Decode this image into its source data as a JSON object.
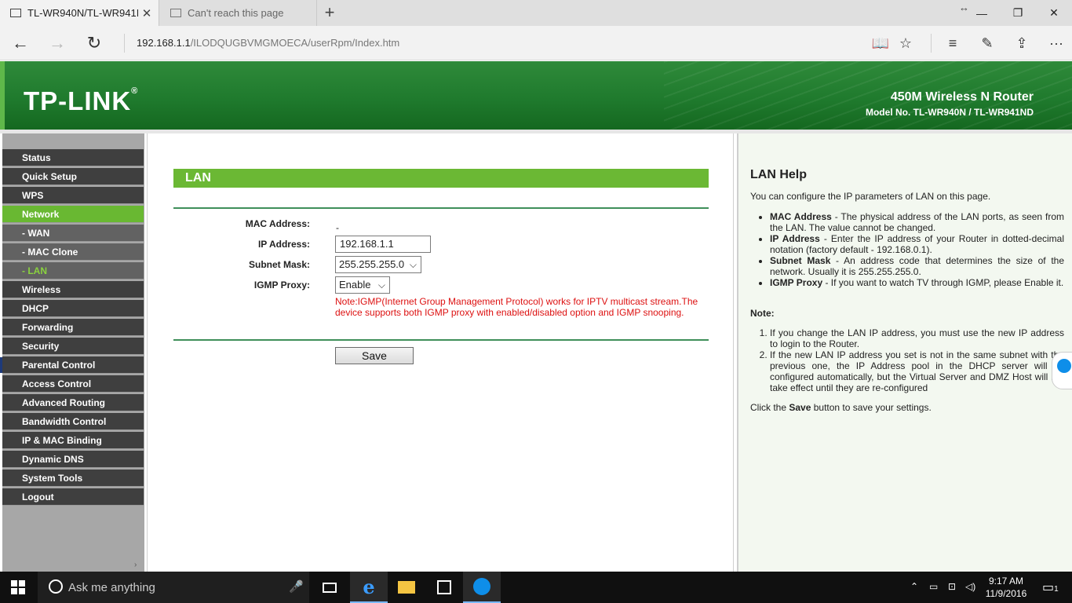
{
  "browser": {
    "tabs": [
      {
        "title": "TL-WR940N/TL-WR941I",
        "close": "✕"
      },
      {
        "title": "Can't reach this page"
      }
    ],
    "new_tab": "+",
    "tab_move": "↔",
    "window": {
      "minimize": "—",
      "maximize": "❐",
      "close": "✕"
    },
    "nav": {
      "back": "←",
      "forward": "→",
      "refresh": "↻"
    },
    "url_host": "192.168.1.1",
    "url_path": "/ILODQUGBVMGMOECA/userRpm/Index.htm",
    "tools": {
      "reading": "📖",
      "favorite": "☆",
      "hub": "≡",
      "note": "✎",
      "share": "⇪",
      "more": "···"
    }
  },
  "banner": {
    "logo": "TP-LINK",
    "logo_mark": "®",
    "product": "450M Wireless N Router",
    "model": "Model No. TL-WR940N / TL-WR941ND"
  },
  "menu": {
    "items": [
      {
        "label": "Status",
        "type": "main"
      },
      {
        "label": "Quick Setup",
        "type": "main"
      },
      {
        "label": "WPS",
        "type": "main"
      },
      {
        "label": "Network",
        "type": "active"
      },
      {
        "label": "- WAN",
        "type": "sub"
      },
      {
        "label": "- MAC Clone",
        "type": "sub"
      },
      {
        "label": "- LAN",
        "type": "sub-active"
      },
      {
        "label": "Wireless",
        "type": "main"
      },
      {
        "label": "DHCP",
        "type": "main"
      },
      {
        "label": "Forwarding",
        "type": "main"
      },
      {
        "label": "Security",
        "type": "main"
      },
      {
        "label": "Parental Control",
        "type": "main"
      },
      {
        "label": "Access Control",
        "type": "main"
      },
      {
        "label": "Advanced Routing",
        "type": "main"
      },
      {
        "label": "Bandwidth Control",
        "type": "main"
      },
      {
        "label": "IP & MAC Binding",
        "type": "main"
      },
      {
        "label": "Dynamic DNS",
        "type": "main"
      },
      {
        "label": "System Tools",
        "type": "main"
      },
      {
        "label": "Logout",
        "type": "main"
      }
    ],
    "scroll_arrow": "›"
  },
  "lan": {
    "title": "LAN",
    "mac_label": "MAC Address:",
    "mac_value": "-",
    "ip_label": "IP Address:",
    "ip_value": "192.168.1.1",
    "mask_label": "Subnet Mask:",
    "mask_value": "255.255.255.0",
    "igmp_label": "IGMP Proxy:",
    "igmp_value": "Enable",
    "chevron": "⌵",
    "note": "Note:IGMP(Internet Group Management Protocol) works for IPTV multicast stream.The device supports both IGMP proxy with enabled/disabled option and IGMP snooping.",
    "save": "Save"
  },
  "help": {
    "title": "LAN Help",
    "intro": "You can configure the IP parameters of LAN on this page.",
    "items": [
      {
        "term": "MAC Address",
        "text": " - The physical address of the LAN ports, as seen from the LAN. The value cannot be changed."
      },
      {
        "term": "IP Address",
        "text": " - Enter the IP address of your Router in dotted-decimal notation (factory default - 192.168.0.1)."
      },
      {
        "term": "Subnet Mask",
        "text": " - An address code that determines the size of the network. Usually it is 255.255.255.0."
      },
      {
        "term": "IGMP Proxy",
        "text": " - If you want to watch TV through IGMP, please Enable it."
      }
    ],
    "note_label": "Note:",
    "notes": [
      "If you change the LAN IP address, you must use the new IP address to login to the Router.",
      "If the new LAN IP address you set is not in the same subnet with the previous one, the IP Address pool in the DHCP server will be configured automatically, but the Virtual Server and DMZ Host will not take effect until they are re-configured"
    ],
    "save_pre": "Click the ",
    "save_word": "Save",
    "save_post": " button to save your settings."
  },
  "taskbar": {
    "search_placeholder": "Ask me anything",
    "mic": "🎤",
    "tray": {
      "chevron": "⌃",
      "battery": "▭",
      "network": "⊡",
      "volume": "◁)"
    },
    "time": "9:17 AM",
    "date": "11/9/2016",
    "notification": "1"
  }
}
